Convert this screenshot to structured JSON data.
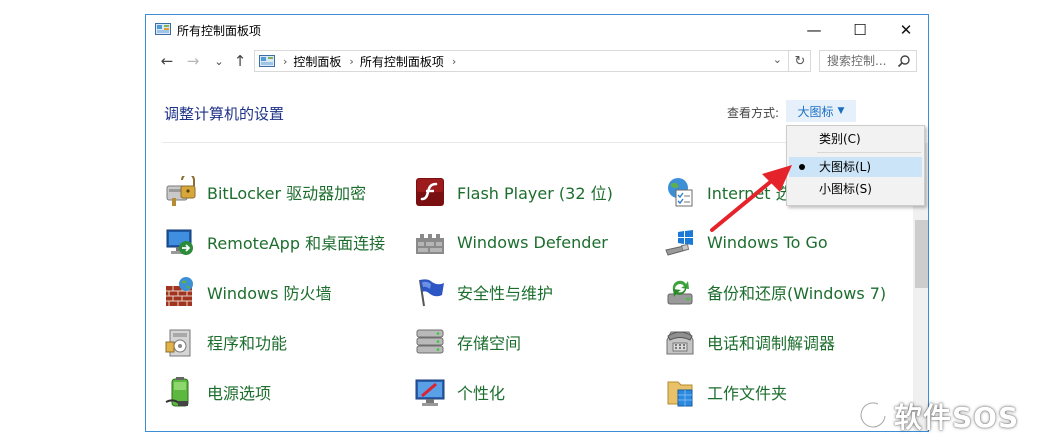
{
  "window": {
    "title": "所有控制面板项",
    "minimize_glyph": "—",
    "maximize_glyph": "☐",
    "close_glyph": "✕"
  },
  "nav": {
    "back_glyph": "←",
    "forward_glyph": "→",
    "recent_glyph": "⌄",
    "up_glyph": "↑",
    "breadcrumb": [
      "控制面板",
      "所有控制面板项"
    ],
    "breadcrumb_sep": "›",
    "refresh_glyph": "↻",
    "dropdown_glyph": "⌄",
    "search_placeholder": "搜索控制..."
  },
  "header": {
    "title": "调整计算机的设置",
    "view_by_label": "查看方式:",
    "view_by_value": "大图标",
    "view_caret": "▼"
  },
  "view_menu": {
    "items": [
      {
        "label": "类别(C)",
        "selected": false
      },
      {
        "label": "大图标(L)",
        "selected": true
      },
      {
        "label": "小图标(S)",
        "selected": false
      }
    ]
  },
  "items": [
    {
      "label": "BitLocker 驱动器加密",
      "icon": "bitlocker-icon"
    },
    {
      "label": "Flash Player (32 位)",
      "icon": "flash-icon"
    },
    {
      "label": "Internet 选",
      "icon": "internet-options-icon"
    },
    {
      "label": "RemoteApp 和桌面连接",
      "icon": "remoteapp-icon"
    },
    {
      "label": "Windows Defender",
      "icon": "defender-icon"
    },
    {
      "label": "Windows To Go",
      "icon": "windows-to-go-icon"
    },
    {
      "label": "Windows 防火墙",
      "icon": "firewall-icon"
    },
    {
      "label": "安全性与维护",
      "icon": "security-flag-icon"
    },
    {
      "label": "备份和还原(Windows 7)",
      "icon": "backup-icon"
    },
    {
      "label": "程序和功能",
      "icon": "programs-icon"
    },
    {
      "label": "存储空间",
      "icon": "storage-icon"
    },
    {
      "label": "电话和调制解调器",
      "icon": "phone-icon"
    },
    {
      "label": "电源选项",
      "icon": "power-icon"
    },
    {
      "label": "个性化",
      "icon": "personalization-icon"
    },
    {
      "label": "工作文件夹",
      "icon": "work-folders-icon"
    }
  ],
  "watermark": {
    "text": "软件SOS"
  },
  "colors": {
    "accent": "#1a6fc2",
    "link_green": "#1d6e2e",
    "heading_blue": "#1e3287",
    "arrow_red": "#e5232a"
  }
}
